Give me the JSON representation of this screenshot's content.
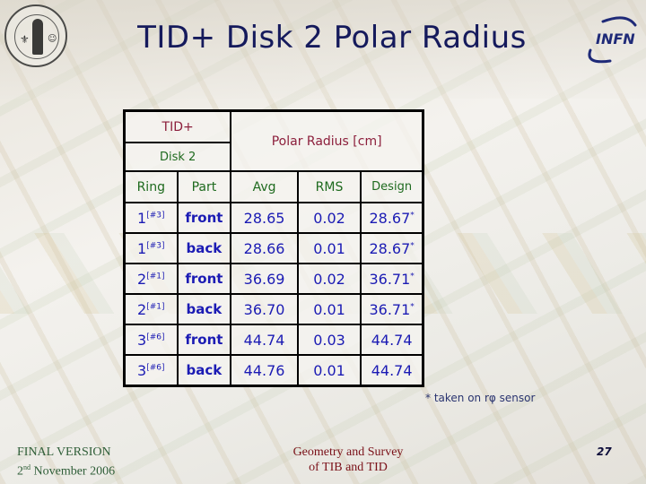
{
  "slide": {
    "title": "TID+ Disk 2 Polar Radius",
    "logos": {
      "left": "university-seal",
      "right_text": "INFN"
    }
  },
  "table": {
    "header": {
      "detector": "TID+",
      "disk": "Disk 2",
      "group": "Polar Radius [cm]",
      "columns": [
        "Ring",
        "Part",
        "Avg",
        "RMS",
        "Design"
      ]
    },
    "rows": [
      {
        "ring": "1",
        "ring_ref": "[#3]",
        "part": "front",
        "avg": "28.65",
        "rms": "0.02",
        "design": "28.67",
        "design_mark": "*"
      },
      {
        "ring": "1",
        "ring_ref": "[#3]",
        "part": "back",
        "avg": "28.66",
        "rms": "0.01",
        "design": "28.67",
        "design_mark": "*"
      },
      {
        "ring": "2",
        "ring_ref": "[#1]",
        "part": "front",
        "avg": "36.69",
        "rms": "0.02",
        "design": "36.71",
        "design_mark": "*"
      },
      {
        "ring": "2",
        "ring_ref": "[#1]",
        "part": "back",
        "avg": "36.70",
        "rms": "0.01",
        "design": "36.71",
        "design_mark": "*"
      },
      {
        "ring": "3",
        "ring_ref": "[#6]",
        "part": "front",
        "avg": "44.74",
        "rms": "0.03",
        "design": "44.74",
        "design_mark": ""
      },
      {
        "ring": "3",
        "ring_ref": "[#6]",
        "part": "back",
        "avg": "44.76",
        "rms": "0.01",
        "design": "44.74",
        "design_mark": ""
      }
    ]
  },
  "note": "* taken on rφ sensor",
  "footer": {
    "left_line1": "FINAL VERSION",
    "left_line2_day": "2",
    "left_line2_sup": "nd",
    "left_line2_rest": " November 2006",
    "center_line1": "Geometry and Survey",
    "center_line2": "of TIB and TID",
    "page_number": "27"
  }
}
